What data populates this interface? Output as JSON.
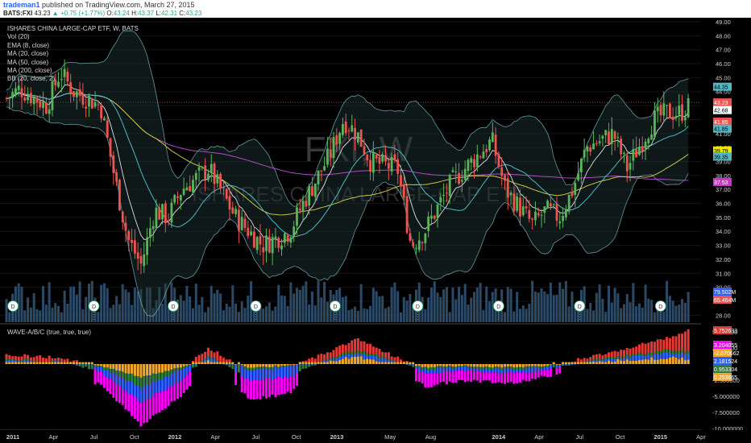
{
  "header": {
    "author": "trademan1",
    "published": "published on TradingView.com, March 27, 2015",
    "symbol": "BATS:FXI",
    "last": "43.23",
    "change": "+0.75 (+1.77%)",
    "o_label": "O:",
    "open": "43.24",
    "h_label": "H:",
    "high": "43.37",
    "l_label": "L:",
    "low": "42.31",
    "c_label": "C:",
    "close": "43.23"
  },
  "legend": {
    "title": "ISHARES CHINA LARGE-CAP ETF, W, BATS",
    "items": [
      "Vol (20)",
      "EMA (8, close)",
      "MA (20, close)",
      "MA (50, close)",
      "MA (200, close)",
      "BB (20, close, 2)"
    ]
  },
  "watermark": {
    "symbol": "FXI, W",
    "name": "ISHARES CHINA LARGE-CAP ETF"
  },
  "wave_label": "WAVE-A/B/C (true, true, true)",
  "colors": {
    "background": "#000000",
    "up": "#5ab55a",
    "down": "#ef5350",
    "ema8": "#e0e0e0",
    "ma20": "#4fb8c4",
    "ma50": "#c8c84a",
    "ma200": "#b04cc4",
    "bb": "#8fd3d3",
    "volume": "#2c4a66",
    "wave_a": "#ff00ff",
    "wave_b": "#2962ff",
    "wave_c": "#e53935",
    "wave_g": "#2e7d32",
    "wave_o": "#f5a623"
  },
  "chart_data": [
    {
      "type": "line",
      "title": "ISHARES CHINA LARGE-CAP ETF, W, BATS",
      "interval": "W",
      "x_ticks": [
        "2011",
        "Apr",
        "Jul",
        "Oct",
        "2012",
        "Apr",
        "Jul",
        "Oct",
        "2013",
        "May",
        "Aug",
        "2014",
        "Apr",
        "Jul",
        "Oct",
        "2015",
        "Apr"
      ],
      "ylim": [
        27.5,
        49.0
      ],
      "y_ticks": [
        "28.00",
        "29.00",
        "30.00",
        "31.00",
        "32.00",
        "33.00",
        "34.00",
        "35.00",
        "36.00",
        "37.00",
        "38.00",
        "39.00",
        "40.00",
        "41.00",
        "42.00",
        "43.00",
        "44.00",
        "45.00",
        "46.00",
        "47.00",
        "48.00",
        "49.00"
      ],
      "close_series_keypoints": [
        {
          "date": "2010-12",
          "close": 43.5
        },
        {
          "date": "2011-01",
          "close": 44.2
        },
        {
          "date": "2011-03",
          "close": 43.0
        },
        {
          "date": "2011-04",
          "close": 45.4
        },
        {
          "date": "2011-05",
          "close": 44.0
        },
        {
          "date": "2011-07",
          "close": 43.0
        },
        {
          "date": "2011-08",
          "close": 38.0
        },
        {
          "date": "2011-09",
          "close": 33.5
        },
        {
          "date": "2011-10",
          "close": 31.6
        },
        {
          "date": "2011-11",
          "close": 35.5
        },
        {
          "date": "2011-12",
          "close": 35.0
        },
        {
          "date": "2012-01",
          "close": 37.0
        },
        {
          "date": "2012-03",
          "close": 38.5
        },
        {
          "date": "2012-05",
          "close": 35.0
        },
        {
          "date": "2012-07",
          "close": 33.0
        },
        {
          "date": "2012-09",
          "close": 34.0
        },
        {
          "date": "2012-10",
          "close": 36.0
        },
        {
          "date": "2012-12",
          "close": 39.5
        },
        {
          "date": "2013-01",
          "close": 42.0
        },
        {
          "date": "2013-02",
          "close": 41.0
        },
        {
          "date": "2013-03",
          "close": 39.0
        },
        {
          "date": "2013-05",
          "close": 38.5
        },
        {
          "date": "2013-06",
          "close": 33.0
        },
        {
          "date": "2013-07",
          "close": 34.0
        },
        {
          "date": "2013-09",
          "close": 37.5
        },
        {
          "date": "2013-11",
          "close": 39.5
        },
        {
          "date": "2013-12",
          "close": 40.5
        },
        {
          "date": "2014-01",
          "close": 37.0
        },
        {
          "date": "2014-03",
          "close": 34.5
        },
        {
          "date": "2014-04",
          "close": 35.5
        },
        {
          "date": "2014-05",
          "close": 35.0
        },
        {
          "date": "2014-06",
          "close": 37.0
        },
        {
          "date": "2014-07",
          "close": 40.0
        },
        {
          "date": "2014-09",
          "close": 41.0
        },
        {
          "date": "2014-10",
          "close": 38.5
        },
        {
          "date": "2014-12",
          "close": 42.0
        },
        {
          "date": "2015-01",
          "close": 42.5
        },
        {
          "date": "2015-02",
          "close": 42.5
        },
        {
          "date": "2015-03",
          "close": 43.23
        }
      ],
      "price_labels": [
        {
          "value": "44.35",
          "color": "#4fb8c4",
          "price": 44.35
        },
        {
          "value": "43.23",
          "color": "#ef5350",
          "price": 43.23
        },
        {
          "value": "42.68",
          "color": "#ffffff",
          "price": 42.68
        },
        {
          "value": "41.85",
          "color": "#ef5350",
          "price": 41.85
        },
        {
          "value": "41.85",
          "color": "#4fb8c4",
          "price": 41.35
        },
        {
          "value": "39.79",
          "color": "#e6e600",
          "price": 39.79
        },
        {
          "value": "39.35",
          "color": "#4fb8c4",
          "price": 39.35
        },
        {
          "value": "37.53",
          "color": "#cc33cc",
          "price": 37.53
        }
      ],
      "volume_labels": [
        "79.502M",
        "65.464M"
      ],
      "dividend_markers": [
        "D",
        "D",
        "D",
        "D",
        "D",
        "D",
        "D",
        "D",
        "D"
      ]
    },
    {
      "type": "bar",
      "title": "WAVE-A/B/C (true, true, true)",
      "ylim": [
        -10.0,
        6.0
      ],
      "y_ticks": [
        "-10.000000",
        "-7.500000",
        "-5.000000",
        "-2.500000",
        "2.500000",
        "5.000000"
      ],
      "series": [
        {
          "name": "A",
          "last": "-2.670662"
        },
        {
          "name": "B",
          "last": "2.181524"
        },
        {
          "name": "C",
          "last": "5.752633"
        }
      ],
      "value_labels": [
        {
          "value": "5.752633",
          "color": "#e53935"
        },
        {
          "value": "3.204055",
          "color": "#ff00ff"
        },
        {
          "value": "-2.670662",
          "color": "#f5a623"
        },
        {
          "value": "2.181524",
          "color": "#2962ff"
        },
        {
          "value": "0.953304",
          "color": "#2e7d32"
        },
        {
          "value": "0.253665",
          "color": "#f5a623"
        }
      ],
      "keypoints": [
        {
          "date": "2010-12",
          "c": 1.5,
          "b": 0.8,
          "a": -1.0
        },
        {
          "date": "2011-04",
          "c": 1.0,
          "b": 0.5,
          "a": -2.0
        },
        {
          "date": "2011-07",
          "c": -0.5,
          "b": -1.2,
          "a": -3.0
        },
        {
          "date": "2011-10",
          "c": -4.0,
          "b": -6.0,
          "a": -9.5
        },
        {
          "date": "2012-01",
          "c": -1.0,
          "b": -2.5,
          "a": -5.0
        },
        {
          "date": "2012-03",
          "c": 2.5,
          "b": 1.5,
          "a": 1.0
        },
        {
          "date": "2012-06",
          "c": -1.0,
          "b": -2.5,
          "a": -5.5
        },
        {
          "date": "2012-09",
          "c": -0.5,
          "b": -2.0,
          "a": -4.5
        },
        {
          "date": "2012-12",
          "c": 2.0,
          "b": 1.0,
          "a": 0.5
        },
        {
          "date": "2013-02",
          "c": 4.0,
          "b": 2.5,
          "a": 1.5
        },
        {
          "date": "2013-05",
          "c": 1.0,
          "b": 0.5,
          "a": -0.5
        },
        {
          "date": "2013-07",
          "c": -1.0,
          "b": -1.5,
          "a": -3.5
        },
        {
          "date": "2013-10",
          "c": -0.5,
          "b": -1.0,
          "a": -2.5
        },
        {
          "date": "2014-01",
          "c": -1.0,
          "b": -1.5,
          "a": -3.0
        },
        {
          "date": "2014-04",
          "c": -0.5,
          "b": -1.0,
          "a": -2.0
        },
        {
          "date": "2014-07",
          "c": 1.0,
          "b": 0.5,
          "a": 0.2
        },
        {
          "date": "2014-10",
          "c": 2.5,
          "b": 1.5,
          "a": 0.8
        },
        {
          "date": "2015-01",
          "c": 4.0,
          "b": 2.5,
          "a": 1.2
        },
        {
          "date": "2015-03",
          "c": 5.752633,
          "b": 2.181524,
          "a": 0.953304
        }
      ]
    }
  ]
}
